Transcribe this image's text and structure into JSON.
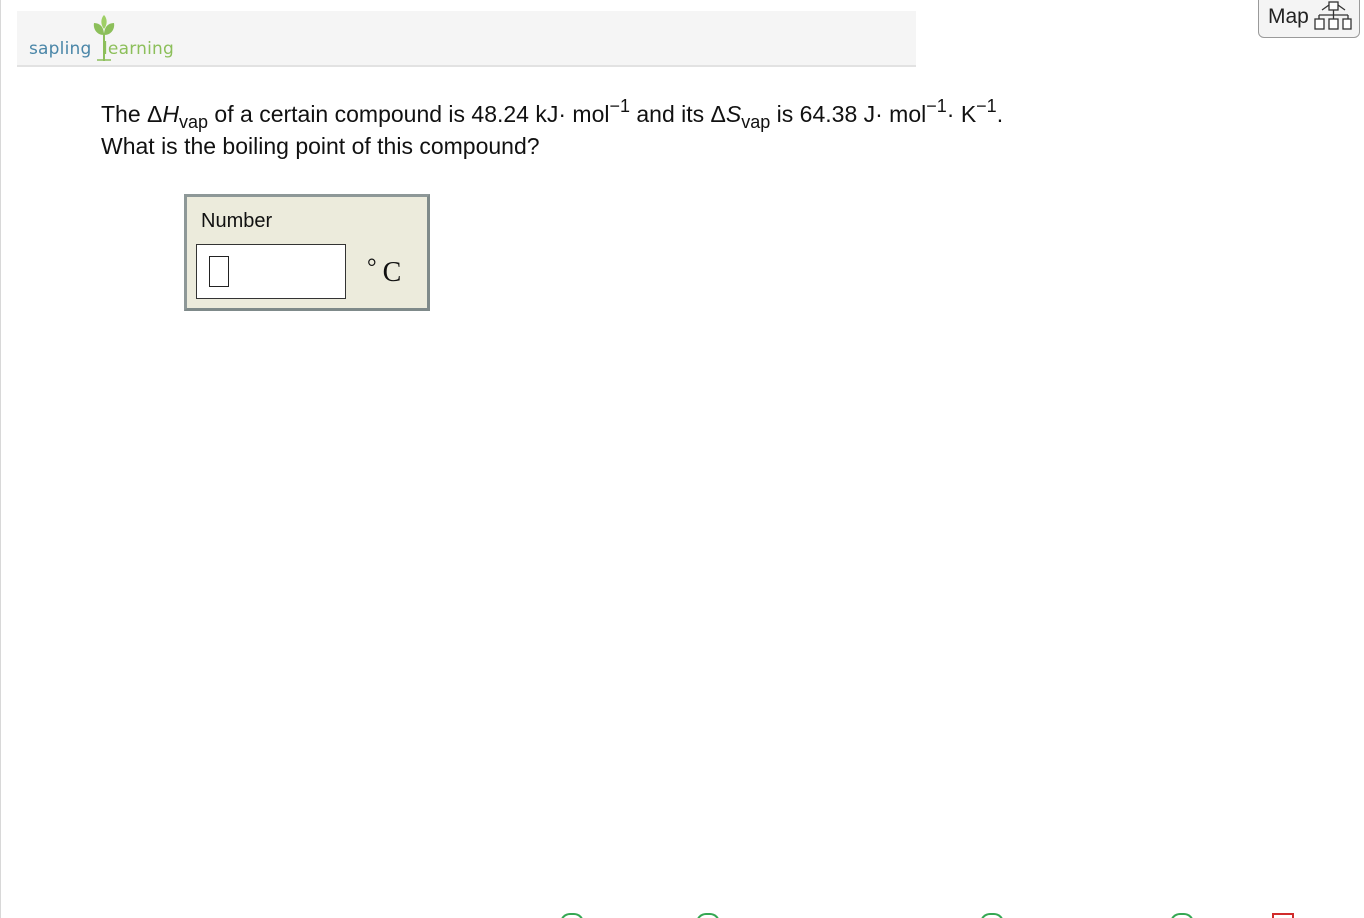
{
  "header": {
    "logo_text_left": "sapling",
    "logo_text_right": "learning"
  },
  "map_button": {
    "label": "Map",
    "icon": "sitemap-icon"
  },
  "question": {
    "p1": "The Δ",
    "H": "H",
    "sub_vap1": "vap",
    "p2": " of a certain compound is 48.24 kJ· mol",
    "sup1": "−1",
    "p3": " and its Δ",
    "S": "S",
    "sub_vap2": "vap",
    "p4": " is 64.38 J· mol",
    "sup2": "−1",
    "p5": "· K",
    "sup3": "−1",
    "p6": ".",
    "line2": "What is the boiling point of this compound?"
  },
  "answer": {
    "label": "Number",
    "value": "",
    "unit_degree": "°",
    "unit": "C"
  },
  "colors": {
    "brand_blue": "#4a86a8",
    "brand_green": "#8cbf5a",
    "answer_bg": "#ecebdc"
  }
}
